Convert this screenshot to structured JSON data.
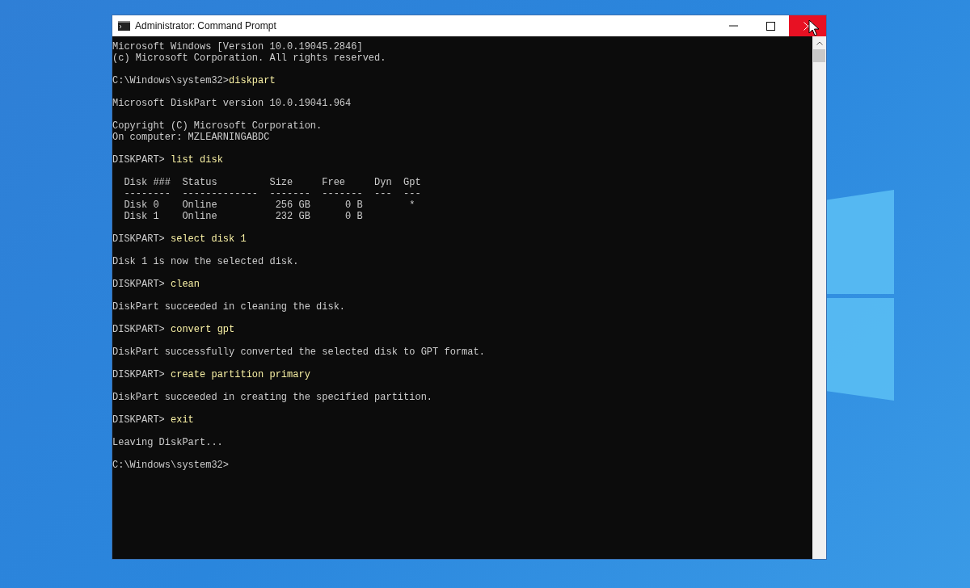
{
  "window": {
    "title": "Administrator: Command Prompt",
    "controls": [
      {
        "kind": "minimize",
        "hovered": false
      },
      {
        "kind": "maximize",
        "hovered": false
      },
      {
        "kind": "close",
        "hovered": true
      }
    ]
  },
  "console": {
    "lines": [
      {
        "kind": "output",
        "text": "Microsoft Windows [Version 10.0.19045.2846]"
      },
      {
        "kind": "output",
        "text": "(c) Microsoft Corporation. All rights reserved."
      },
      {
        "kind": "blank"
      },
      {
        "kind": "command",
        "prompt": "C:\\Windows\\system32>",
        "command": "diskpart"
      },
      {
        "kind": "blank"
      },
      {
        "kind": "output",
        "text": "Microsoft DiskPart version 10.0.19041.964"
      },
      {
        "kind": "blank"
      },
      {
        "kind": "output",
        "text": "Copyright (C) Microsoft Corporation."
      },
      {
        "kind": "output",
        "text": "On computer: MZLEARNINGABDC"
      },
      {
        "kind": "blank"
      },
      {
        "kind": "command",
        "prompt": "DISKPART> ",
        "command": "list disk"
      },
      {
        "kind": "blank"
      },
      {
        "kind": "output",
        "text": "  Disk ###  Status         Size     Free     Dyn  Gpt"
      },
      {
        "kind": "output",
        "text": "  --------  -------------  -------  -------  ---  ---"
      },
      {
        "kind": "output",
        "text": "  Disk 0    Online          256 GB      0 B        *"
      },
      {
        "kind": "output",
        "text": "  Disk 1    Online          232 GB      0 B"
      },
      {
        "kind": "blank"
      },
      {
        "kind": "command",
        "prompt": "DISKPART> ",
        "command": "select disk 1"
      },
      {
        "kind": "blank"
      },
      {
        "kind": "output",
        "text": "Disk 1 is now the selected disk."
      },
      {
        "kind": "blank"
      },
      {
        "kind": "command",
        "prompt": "DISKPART> ",
        "command": "clean"
      },
      {
        "kind": "blank"
      },
      {
        "kind": "output",
        "text": "DiskPart succeeded in cleaning the disk."
      },
      {
        "kind": "blank"
      },
      {
        "kind": "command",
        "prompt": "DISKPART> ",
        "command": "convert gpt"
      },
      {
        "kind": "blank"
      },
      {
        "kind": "output",
        "text": "DiskPart successfully converted the selected disk to GPT format."
      },
      {
        "kind": "blank"
      },
      {
        "kind": "command",
        "prompt": "DISKPART> ",
        "command": "create partition primary"
      },
      {
        "kind": "blank"
      },
      {
        "kind": "output",
        "text": "DiskPart succeeded in creating the specified partition."
      },
      {
        "kind": "blank"
      },
      {
        "kind": "command",
        "prompt": "DISKPART> ",
        "command": "exit"
      },
      {
        "kind": "blank"
      },
      {
        "kind": "output",
        "text": "Leaving DiskPart..."
      },
      {
        "kind": "blank"
      },
      {
        "kind": "output",
        "text": "C:\\Windows\\system32>"
      }
    ]
  }
}
